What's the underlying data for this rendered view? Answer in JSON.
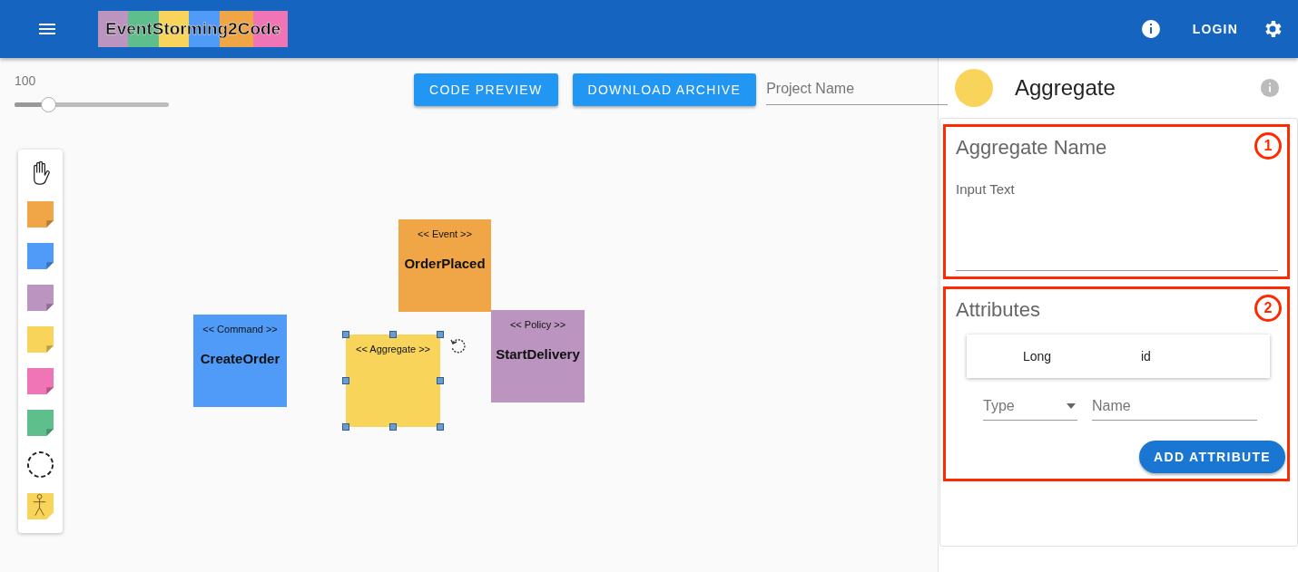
{
  "app_bar": {
    "logo": "EventStorming2Code",
    "login": "LOGIN"
  },
  "zoom": {
    "value": "100",
    "level": 0.22
  },
  "toolbar": {
    "buttons": [
      "CODE PREVIEW",
      "DOWNLOAD ARCHIVE"
    ],
    "project_name": {
      "placeholder": "Project Name"
    }
  },
  "palette": [
    {
      "kind": "hand"
    },
    {
      "kind": "sticky",
      "color": "#f0a646"
    },
    {
      "kind": "sticky",
      "color": "#4f9bf7"
    },
    {
      "kind": "sticky",
      "color": "#bb94c0"
    },
    {
      "kind": "sticky",
      "color": "#f8d45a"
    },
    {
      "kind": "sticky",
      "color": "#ef75b6"
    },
    {
      "kind": "sticky",
      "color": "#5fbf8c"
    },
    {
      "kind": "boundary"
    },
    {
      "kind": "actor",
      "color": "#f8d45a"
    }
  ],
  "stickies": [
    {
      "stereotype": "<< Command >>",
      "name": "CreateOrder",
      "color": "#4f9bf7",
      "selected": false
    },
    {
      "stereotype": "<< Event >>",
      "name": "OrderPlaced",
      "color": "#f0a646",
      "selected": false
    },
    {
      "stereotype": "<< Aggregate >>",
      "color": "#f8d45a",
      "selected": true
    },
    {
      "stereotype": "<< Policy >>",
      "name": "StartDelivery",
      "color": "#bb94c0",
      "selected": false
    }
  ],
  "panel": {
    "title": "Aggregate",
    "color": "#f8d45a",
    "name_section": {
      "title": "Aggregate Name",
      "callout": "1",
      "field": {
        "label": "Input Text"
      }
    },
    "attributes_section": {
      "title": "Attributes",
      "callout": "2",
      "rows": [
        {
          "type": "Long",
          "name": "id"
        }
      ],
      "type_select": {
        "placeholder": "Type"
      },
      "name_field": {
        "placeholder": "Name"
      },
      "button": "ADD ATTRIBUTE"
    }
  }
}
